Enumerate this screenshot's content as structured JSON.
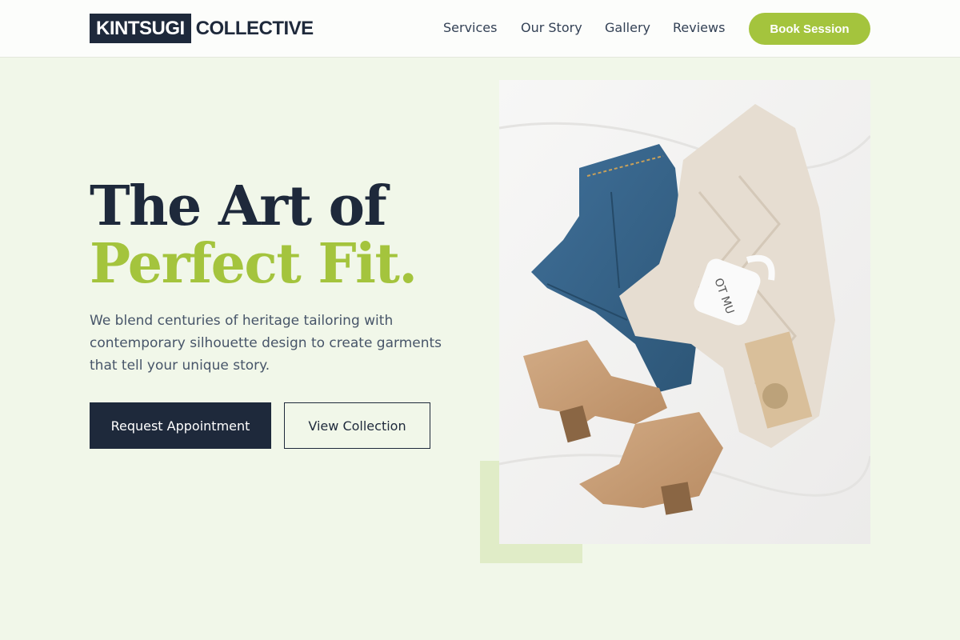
{
  "brand": {
    "logo_box_text": "KINTSUGI",
    "logo_rest_text": "COLLECTIVE"
  },
  "nav": {
    "items": [
      {
        "label": "Services"
      },
      {
        "label": "Our Story"
      },
      {
        "label": "Gallery"
      },
      {
        "label": "Reviews"
      }
    ],
    "cta_label": "Book Session"
  },
  "hero": {
    "headline_line1": "The Art of",
    "headline_line2": "Perfect Fit.",
    "description": "We blend centuries of heritage tailoring with contemporary silhouette design to create garments that tell your unique story.",
    "primary_button": "Request Appointment",
    "secondary_button": "View Collection",
    "image_alt": "Flat lay of jeans, knit sweater, suede boots and a mug"
  },
  "colors": {
    "navy": "#1e293b",
    "accent_green": "#a4c43d",
    "page_bg": "#f1f7e9",
    "accent_block": "#e0ecc7"
  }
}
